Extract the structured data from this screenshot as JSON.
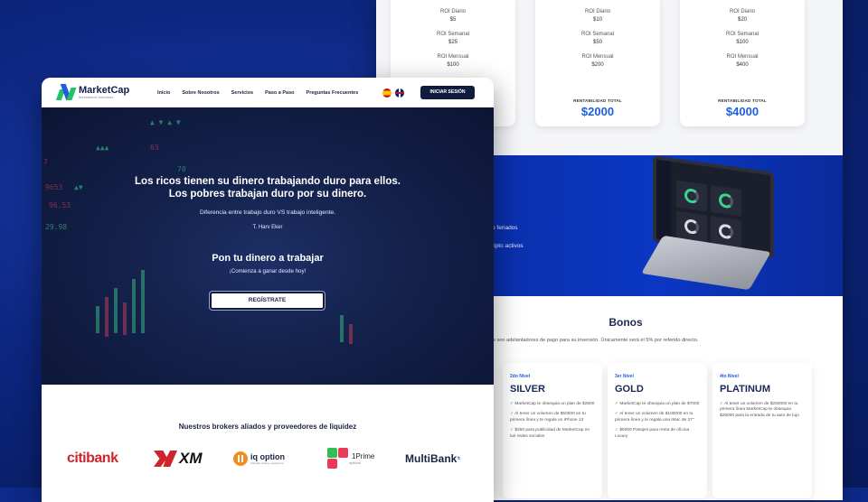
{
  "colors": {
    "background": "#0e2a8a",
    "accent_blue": "#1e5fe0",
    "navy": "#0f1c3d",
    "brand_green": "#23c26b"
  },
  "back_page": {
    "plans": [
      {
        "roi_daily_label": "ROI Diario",
        "roi_daily": "$5",
        "roi_weekly_label": "ROI Semanal",
        "roi_weekly": "$25",
        "roi_monthly_label": "ROI Mensual",
        "roi_monthly": "$100"
      },
      {
        "roi_daily_label": "ROI Diario",
        "roi_daily": "$10",
        "roi_weekly_label": "ROI Semanal",
        "roi_weekly": "$50",
        "roi_monthly_label": "ROI Mensual",
        "roi_monthly": "$200",
        "total_label": "RENTABILIDAD TOTAL",
        "total": "$2000"
      },
      {
        "roi_daily_label": "ROI Diario",
        "roi_daily": "$20",
        "roi_weekly_label": "ROI Semanal",
        "roi_weekly": "$100",
        "roi_monthly_label": "ROI Mensual",
        "roi_monthly": "$400",
        "total_label": "RENTABILIDAD TOTAL",
        "total": "$4000"
      }
    ],
    "band_texts": [
      "o feriados",
      "ripto activos"
    ],
    "bonos_title": "Bonos",
    "bonos_subtitle": "os son adelantadores de pago para su inversión. Únicamente será el 5% por referido directo.",
    "bonos": [
      {
        "level": "2do Nivel",
        "name": "SILVER",
        "features": [
          "MarketCap te obsequia un plan de $2500",
          "Al tener un volumen de $50000 en tu primera línea y te regala un iPhone 13",
          "$250 para publicidad de MarketCap en tus redes sociales"
        ]
      },
      {
        "level": "3er Nivel",
        "name": "GOLD",
        "features": [
          "MarketCap te obsequia un plan de $7000",
          "Al tener un volumen de $100000 en tu primera línea y te regala una iMac de 27\"",
          "$5000 Pasajes para renta de oficina Luxury"
        ]
      },
      {
        "level": "4to Nivel",
        "name": "PLATINUM",
        "features": [
          "Al tener un volumen de $250000 en tu primera línea MarketCap te obsequia $25000 para la entrada de tu auto de lujo"
        ]
      }
    ]
  },
  "front_page": {
    "logo": {
      "name": "MarketCap",
      "tagline": "Investment Solutions"
    },
    "nav": [
      "Inicio",
      "Sobre Nosotros",
      "Servicios",
      "Paso a Paso",
      "Preguntas Frecuentes"
    ],
    "login_label": "INICIAR SESIÓN",
    "hero": {
      "quote_line1": "Los ricos tienen su dinero trabajando duro para ellos.",
      "quote_line2": "Los pobres trabajan duro por su dinero.",
      "subtitle": "Diferencia entre trabajo duro VS trabajo inteligente.",
      "author": "T. Harv Eker",
      "cta_title": "Pon tu dinero a trabajar",
      "cta_subtitle": "¡Comienza a ganar desde hoy!",
      "register_label": "REGÍSTRATE",
      "tickers": [
        "9653",
        "96.53",
        "7",
        "29.98",
        "63",
        "70"
      ]
    },
    "brokers": {
      "title": "Nuestros brokers aliados y proveedores de liquidez",
      "items": [
        {
          "name": "citibank",
          "icon": "citibank-logo"
        },
        {
          "name": "XM",
          "icon": "xm-logo"
        },
        {
          "name": "iq option",
          "icon": "iq-option-logo"
        },
        {
          "name": "Prime",
          "icon": "1prime-logo"
        },
        {
          "name": "MultiBank",
          "icon": "multibank-logo"
        }
      ],
      "prime_prefix": "1",
      "prime_sub": "options",
      "iq_tagline": "Ultimate trading experience"
    }
  }
}
